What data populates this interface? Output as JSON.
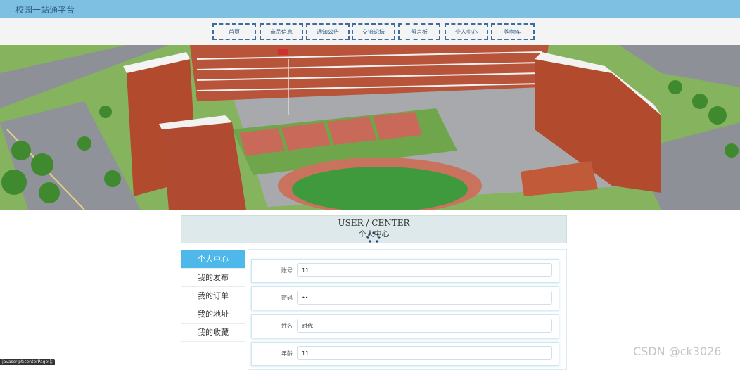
{
  "header": {
    "site_title": "校园一站通平台"
  },
  "nav": {
    "items": [
      {
        "label": "首页"
      },
      {
        "label": "商品信息"
      },
      {
        "label": "通知公告"
      },
      {
        "label": "交流论坛"
      },
      {
        "label": "留言板"
      },
      {
        "label": "个人中心"
      },
      {
        "label": "购物车"
      }
    ]
  },
  "banner": {
    "slide_count": 3,
    "active_slide": 1
  },
  "section": {
    "title_en": "USER / CENTER",
    "title_cn": "个人中心"
  },
  "sidebar": {
    "items": [
      {
        "label": "个人中心",
        "active": true
      },
      {
        "label": "我的发布"
      },
      {
        "label": "我的订单"
      },
      {
        "label": "我的地址"
      },
      {
        "label": "我的收藏"
      }
    ]
  },
  "form": {
    "fields": [
      {
        "label": "账号",
        "value": "11"
      },
      {
        "label": "密码",
        "value": "••"
      },
      {
        "label": "姓名",
        "value": "时代"
      },
      {
        "label": "年龄",
        "value": "11"
      }
    ]
  },
  "statusbar": {
    "text": "javascript:centerPage();"
  },
  "watermark": {
    "text": "CSDN @ck3026"
  },
  "colors": {
    "topbar": "#7ec0e2",
    "nav_border": "#3b6ca2",
    "sidebar_active": "#4db8e9",
    "section_bg": "#dde9ea"
  }
}
